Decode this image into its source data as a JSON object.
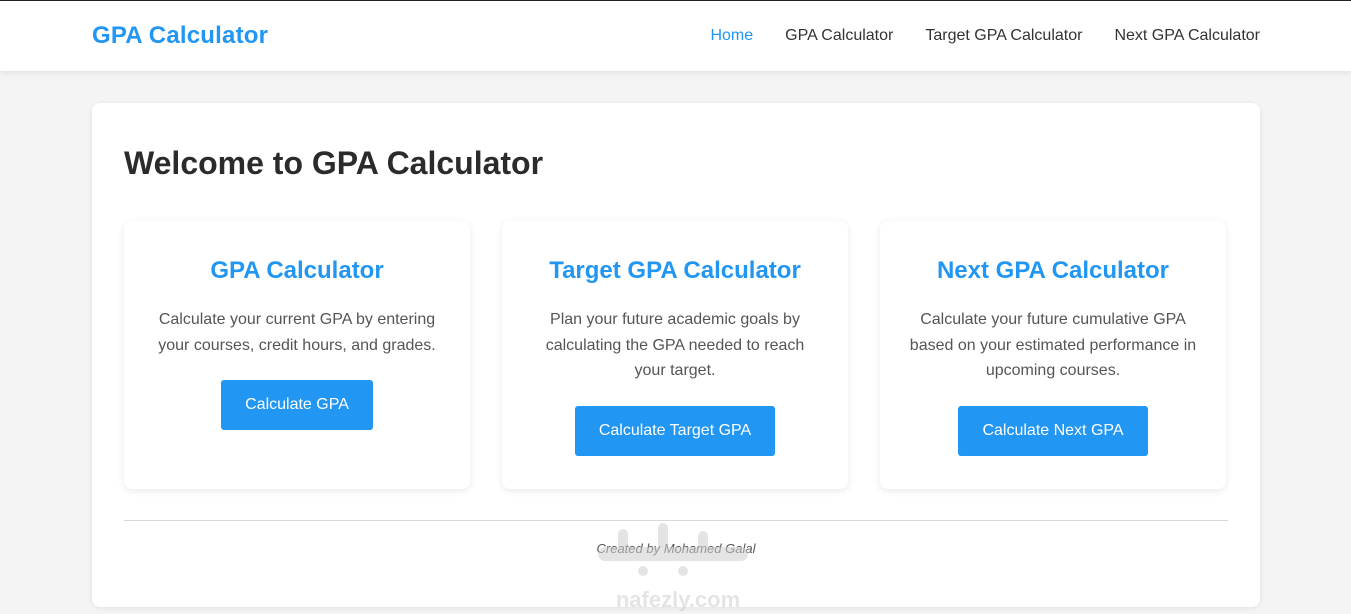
{
  "nav": {
    "brand": "GPA Calculator",
    "links": [
      {
        "label": "Home",
        "active": true
      },
      {
        "label": "GPA Calculator",
        "active": false
      },
      {
        "label": "Target GPA Calculator",
        "active": false
      },
      {
        "label": "Next GPA Calculator",
        "active": false
      }
    ]
  },
  "main": {
    "title": "Welcome to GPA Calculator",
    "cards": [
      {
        "title": "GPA Calculator",
        "description": "Calculate your current GPA by entering your courses, credit hours, and grades.",
        "button": "Calculate GPA"
      },
      {
        "title": "Target GPA Calculator",
        "description": "Plan your future academic goals by calculating the GPA needed to reach your target.",
        "button": "Calculate Target GPA"
      },
      {
        "title": "Next GPA Calculator",
        "description": "Calculate your future cumulative GPA based on your estimated performance in upcoming courses.",
        "button": "Calculate Next GPA"
      }
    ]
  },
  "footer": {
    "credit": "Created by Mohamed Galal"
  },
  "watermark": {
    "text": "nafezly.com"
  },
  "colors": {
    "accent": "#2196f3",
    "text": "#333333",
    "background": "#f4f4f4"
  }
}
